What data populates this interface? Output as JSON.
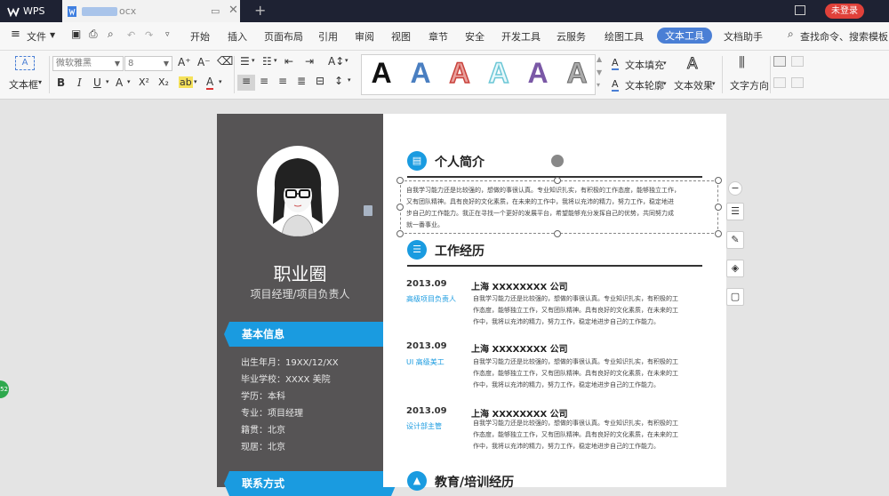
{
  "titlebar": {
    "app_label": "WPS",
    "doc_tab_suffix": "ocx",
    "login_label": "未登录"
  },
  "menu": {
    "file": "文件",
    "items": [
      "开始",
      "插入",
      "页面布局",
      "引用",
      "审阅",
      "视图",
      "章节",
      "安全",
      "开发工具",
      "云服务",
      "绘图工具",
      "文本工具",
      "文档助手"
    ],
    "active_item": "文本工具",
    "search": "查找命令、搜索模板"
  },
  "toolbar": {
    "textbox_label": "文本框",
    "font_name": "微软雅黑",
    "font_size": "8",
    "text_fill": "文本填充",
    "text_outline": "文本轮廓",
    "text_effect": "文本效果",
    "text_direction": "文字方向",
    "wordart_glyph": "A",
    "wordart_colors": [
      "#111111",
      "#4a7fc1",
      "#d9534f",
      "#6cc7d6",
      "#7a58a6",
      "#888888"
    ]
  },
  "resume": {
    "name": "职业圈",
    "role": "项目经理/项目负责人",
    "basic_info_title": "基本信息",
    "info": [
      "出生年月：19XX/12/XX",
      "毕业学校：XXXX 美院",
      "学历：本科",
      "专业：项目经理",
      "籍贯：北京",
      "现居：北京"
    ],
    "contact_title": "联系方式",
    "intro_title": "个人简介",
    "intro_lines": [
      "自我学习能力还是比较强的，想做的事很认真。专业知识扎实，有积极的工作态度，能够独立工作，",
      "又有团队精神。具有良好的文化素质，在未来的工作中，我将以充沛的精力，努力工作，稳定地进",
      "步自己的工作能力。我正在寻找一个更好的发展平台，希望能够充分发挥自己的优势，共同努力成",
      "就一番事业。"
    ],
    "work_title": "工作经历",
    "jobs": [
      {
        "date": "2013.09",
        "role": "高级项目负责人",
        "company": "上海 XXXXXXXX 公司",
        "lines": [
          "自我学习能力还是比较强的，想做的事很认真。专业知识扎实，有积极的工",
          "作态度，能够独立工作，又有团队精神。具有良好的文化素质，在未来的工",
          "作中，我将以充沛的精力，努力工作，稳定地进步自己的工作能力。"
        ]
      },
      {
        "date": "2013.09",
        "role": "UI 高级美工",
        "company": "上海 XXXXXXXX 公司",
        "lines": [
          "自我学习能力还是比较强的，想做的事很认真。专业知识扎实，有积极的工",
          "作态度，能够独立工作，又有团队精神。具有良好的文化素质，在未来的工",
          "作中，我将以充沛的精力，努力工作，稳定地进步自己的工作能力。"
        ]
      },
      {
        "date": "2013.09",
        "role": "设计部主管",
        "company": "上海 XXXXXXXX 公司",
        "lines": [
          "自我学习能力还是比较强的，想做的事很认真。专业知识扎实，有积极的工",
          "作态度，能够独立工作，又有团队精神。具有良好的文化素质，在未来的工",
          "作中，我将以充沛的精力，努力工作，稳定地进步自己的工作能力。"
        ]
      }
    ],
    "education_title": "教育/培训经历"
  },
  "float_badge": "52",
  "colors": {
    "accent": "#1a9be0",
    "sidebar": "#565455",
    "titlebar": "#1e2233",
    "login": "#e0413a"
  }
}
